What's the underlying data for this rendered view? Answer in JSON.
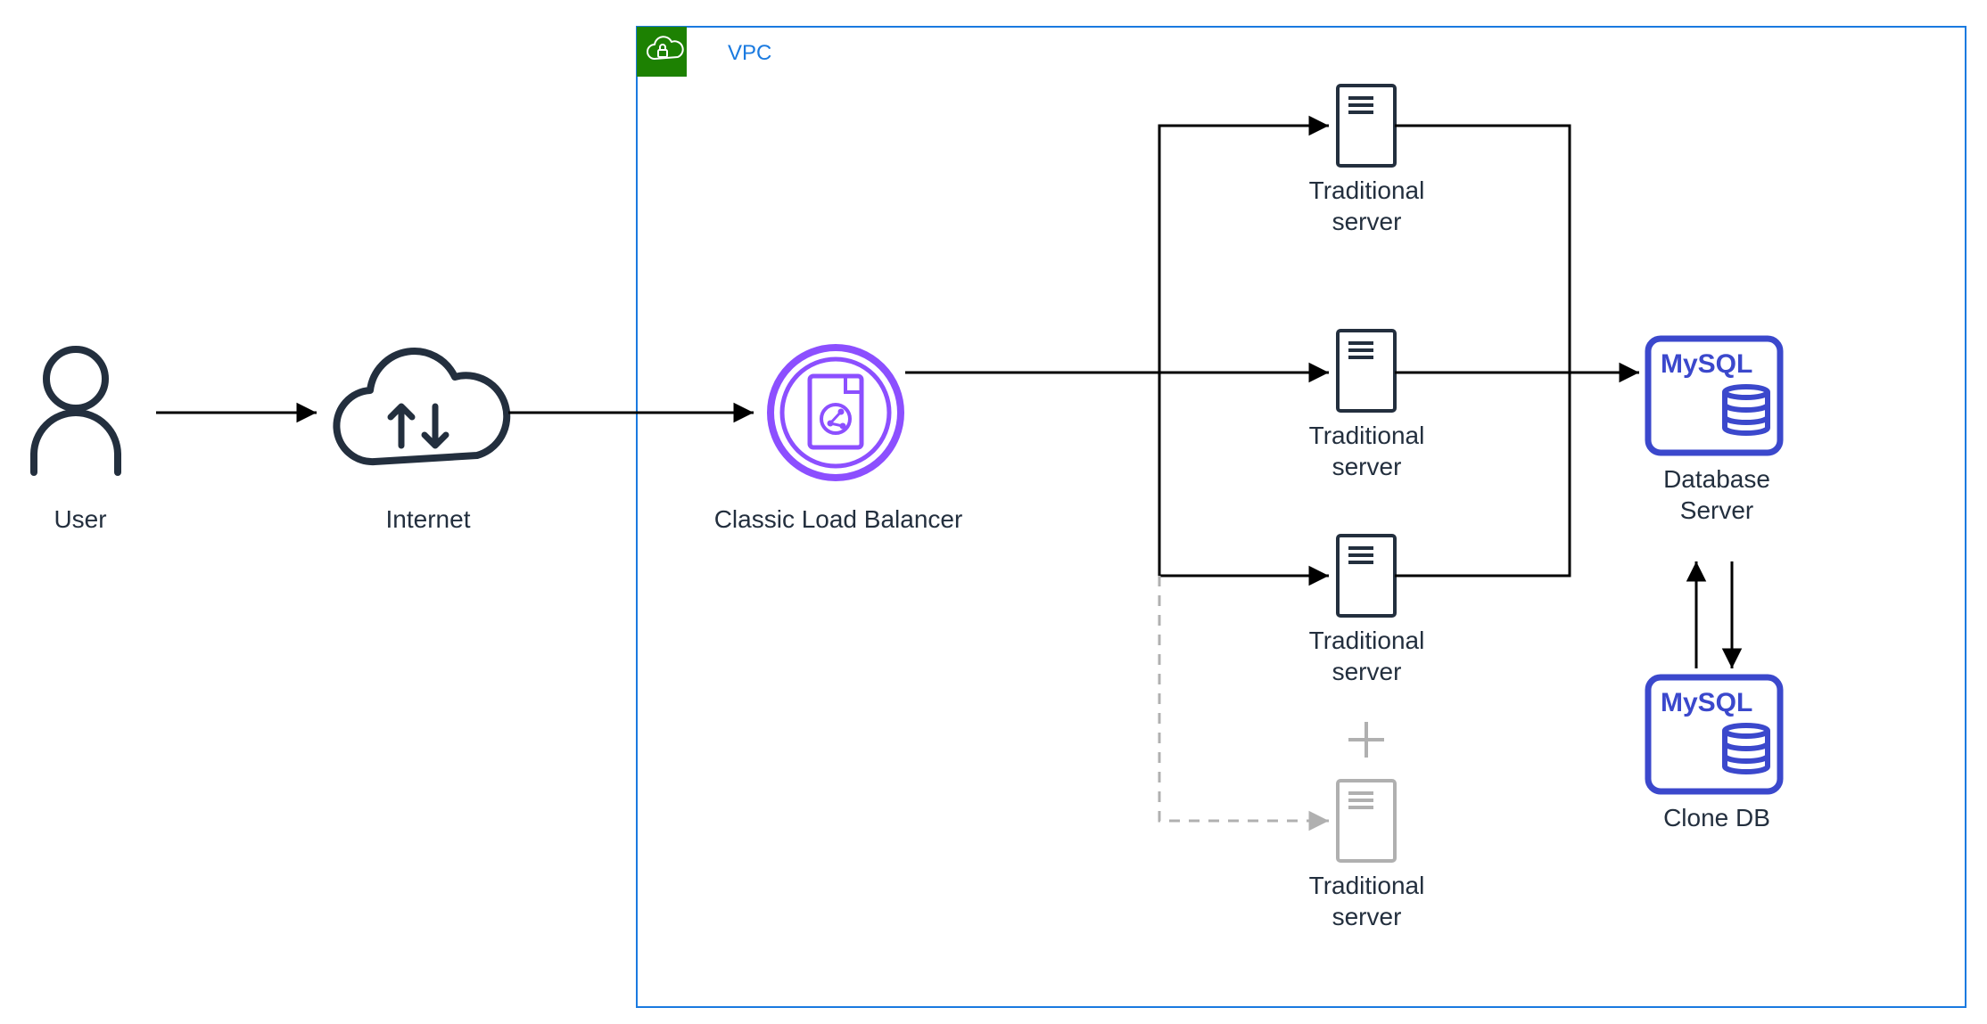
{
  "vpc": {
    "label": "VPC"
  },
  "user": {
    "label": "User"
  },
  "internet": {
    "label": "Internet"
  },
  "loadBalancer": {
    "label": "Classic Load Balancer"
  },
  "servers": {
    "s1": "Traditional\nserver",
    "s2": "Traditional\nserver",
    "s3": "Traditional\nserver",
    "s4": "Traditional\nserver"
  },
  "database": {
    "primaryName": "MySQL",
    "primaryLabel": "Database\nServer",
    "cloneName": "MySQL",
    "cloneLabel": "Clone DB"
  },
  "colors": {
    "stroke": "#232f3e",
    "vpcBorder": "#1a7ae0",
    "vpcBadge": "#1d8102",
    "lb": "#8c4fff",
    "mysql": "#3b48cc",
    "ghost": "#b0b0b0"
  }
}
